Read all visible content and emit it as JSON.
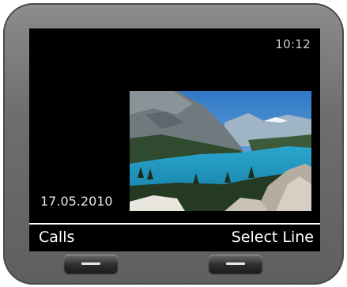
{
  "status_bar": {
    "time": "10:12"
  },
  "idle_screen": {
    "date": "17.05.2010",
    "wallpaper": {
      "subject": "mountain-lake-landscape"
    }
  },
  "softkeys": {
    "left_label": "Calls",
    "right_label": "Select Line"
  },
  "colors": {
    "screen_background": "#000000",
    "device_body": "#6e6e6e",
    "label_text": "#ffffff",
    "lake": "#1f9bc4"
  }
}
